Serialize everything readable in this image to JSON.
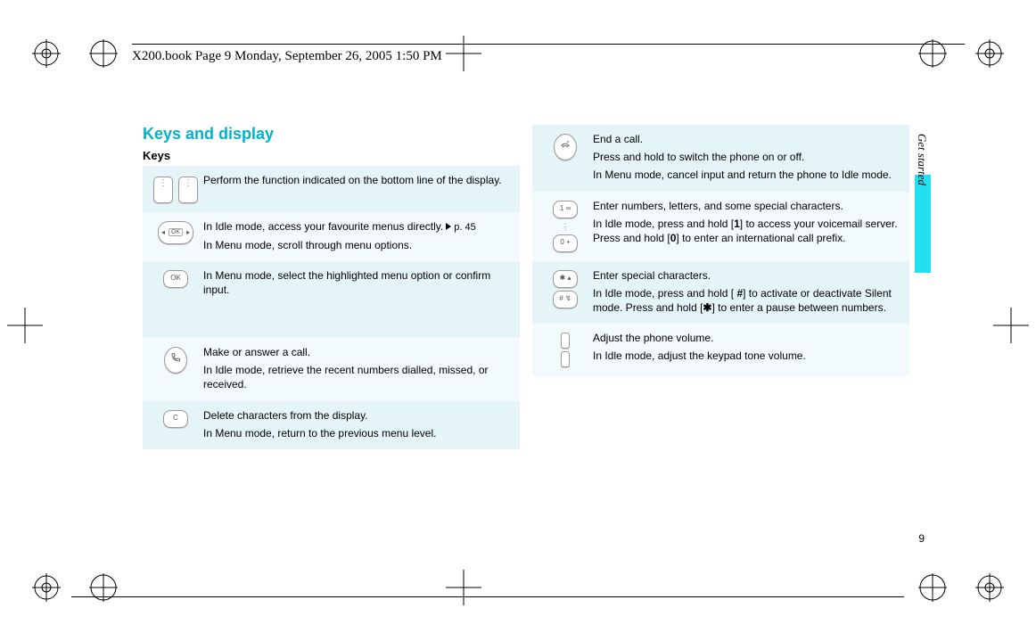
{
  "header": "X200.book  Page 9  Monday, September 26, 2005  1:50 PM",
  "title": "Keys and display",
  "subtitle": "Keys",
  "sideLabel": "Get started",
  "pageNum": "9",
  "left": {
    "r0": "Perform the function indicated on the bottom line of the display.",
    "r1a": "In Idle mode, access your favourite menus directly.",
    "r1ref": "p. 45",
    "r1b": "In Menu mode, scroll through menu options.",
    "r2": "In Menu mode, select the highlighted menu option or confirm input.",
    "r3a": "Make or answer a call.",
    "r3b": "In Idle mode, retrieve the recent numbers dialled, missed, or received.",
    "r4a": "Delete characters from the display.",
    "r4b": "In Menu mode, return to the previous menu level."
  },
  "right": {
    "r0a": "End a call.",
    "r0b": "Press and hold to switch the phone on or off.",
    "r0c": "In Menu mode, cancel input and return the phone to Idle mode.",
    "r1a": "Enter numbers, letters, and some special characters.",
    "r1b_pre": "In Idle mode, press and hold [",
    "r1b_1": "1",
    "r1b_mid": "] to access your voicemail server. Press and hold [",
    "r1b_0": "0",
    "r1b_post": "] to enter an international call prefix.",
    "r2a": "Enter special characters.",
    "r2b_pre": "In Idle mode, press and hold [ ",
    "r2b_hash": "#",
    "r2b_mid": "] to activate or deactivate Silent mode. Press and hold [",
    "r2b_star": "✱",
    "r2b_post": "] to enter a pause between numbers.",
    "r3a": "Adjust the phone volume.",
    "r3b": "In Idle mode, adjust the keypad tone volume."
  }
}
